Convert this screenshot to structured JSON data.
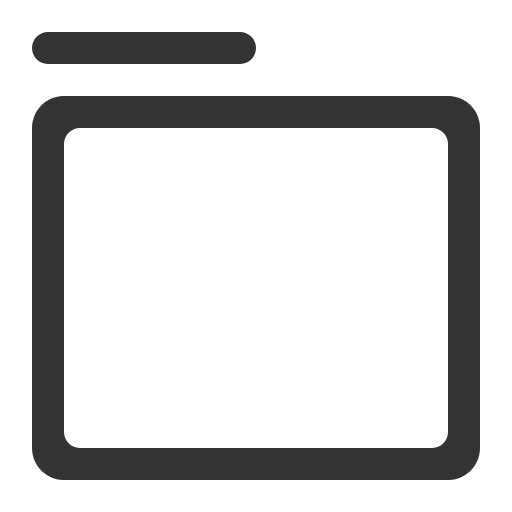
{
  "icon": {
    "name": "tab-icon",
    "color": "#333333",
    "background": "#ffffff"
  }
}
